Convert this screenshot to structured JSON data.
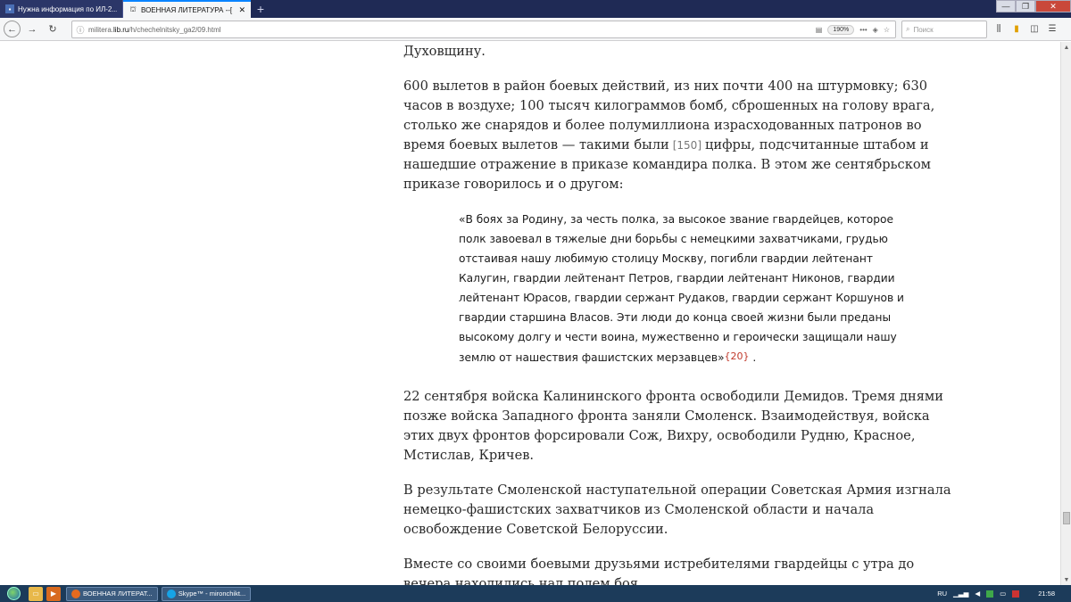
{
  "browser": {
    "tabs": [
      {
        "title": "Нужна информация по ИЛ-2...",
        "active": false
      },
      {
        "title": "ВОЕННАЯ ЛИТЕРАТУРА --[ Во...",
        "active": true
      }
    ],
    "new_tab": "+",
    "url_prefix": "militera.",
    "url_host": "lib.ru",
    "url_path": "/h/chechelnitsky_ga2/09.html",
    "zoom": "190%",
    "search_placeholder": "Поиск"
  },
  "article": {
    "p0": "Духовщину.",
    "p1_before_ref": "600 вылетов в район боевых действий, из них почти 400 на штурмовку; 630 часов в воздухе; 100 тысяч килограммов бомб, сброшенных на голову врага, столько же снарядов и более полумиллиона израсходованных патронов во время боевых вылетов — такими были",
    "p1_ref": "[150]",
    "p1_after_ref": "цифры, подсчитанные штабом и нашедшие отражение в приказе командира полка. В этом же сентябрьском приказе говорилось и о другом:",
    "quote_text": "«В боях за Родину, за честь полка, за высокое звание гвардейцев, которое полк завоевал в тяжелые дни борьбы с немецкими захватчиками, грудью отстаивая нашу любимую столицу Москву, погибли гвардии лейтенант Калугин, гвардии лейтенант Петров, гвардии лейтенант Никонов, гвардии лейтенант Юрасов, гвардии сержант Рудаков, гвардии сержант Коршунов и гвардии старшина Власов. Эти люди до конца своей жизни были преданы высокому долгу и чести воина, мужественно и героически защищали нашу землю от нашествия фашистских мерзавцев»",
    "quote_footnote": "{20}",
    "quote_end": " .",
    "p2": "22 сентября войска Калининского фронта освободили Демидов. Тремя днями позже войска Западного фронта заняли Смоленск. Взаимодействуя, войска этих двух фронтов форсировали Сож, Вихру, освободили Рудню, Красное, Мстислав, Кричев.",
    "p3": "В результате Смоленской наступательной операции Советская Армия изгнала немецко-фашистских захватчиков из Смоленской области и начала освобождение Советской Белоруссии.",
    "p4": "Вместе со своими боевыми друзьями истребителями гвардейцы с утра до вечера находились над полем боя."
  },
  "taskbar": {
    "items": [
      {
        "label": "ВОЕННАЯ ЛИТЕРАТ..."
      },
      {
        "label": "Skype™ - mironchikt..."
      }
    ],
    "language": "RU",
    "time": "21:58"
  }
}
